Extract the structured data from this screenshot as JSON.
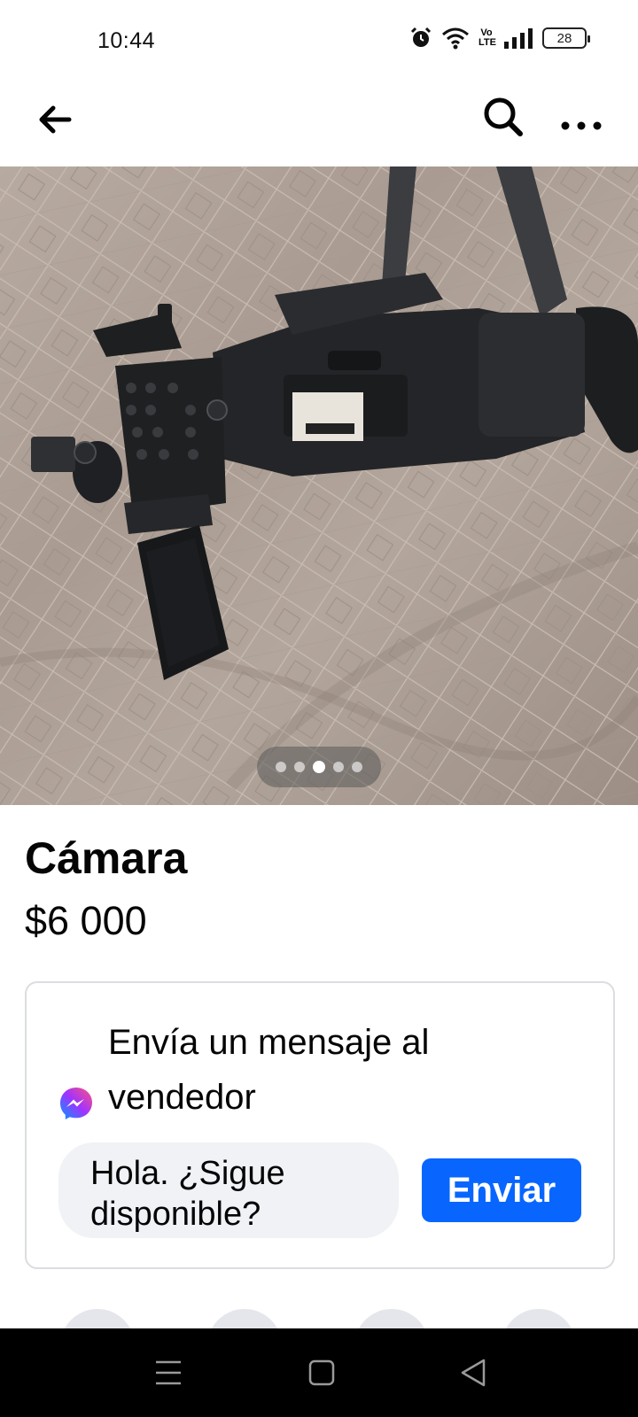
{
  "status_bar": {
    "time": "10:44",
    "icons": [
      "alarm-icon",
      "wifi-icon",
      "volte-icon",
      "signal-icon"
    ],
    "volte_label": "Vo LTE",
    "battery": "28"
  },
  "nav": {
    "back_icon": "arrow-left-icon",
    "search_icon": "search-icon",
    "more_icon": "more-dots-icon"
  },
  "photo": {
    "subject": "camera-photo",
    "pager": {
      "count": 5,
      "active_index": 2
    }
  },
  "listing": {
    "title": "Cámara",
    "price": "$6 000"
  },
  "message_card": {
    "heading": "Envía un mensaje al vendedor",
    "input_value": "Hola. ¿Sigue disponible?",
    "send_label": "Enviar",
    "icon": "messenger-icon"
  },
  "colors": {
    "accent": "#0866ff",
    "input_bg": "#f0f2f5",
    "card_border": "#dadde1"
  },
  "system_nav": [
    "menu-icon",
    "home-icon",
    "back-triangle-icon"
  ]
}
